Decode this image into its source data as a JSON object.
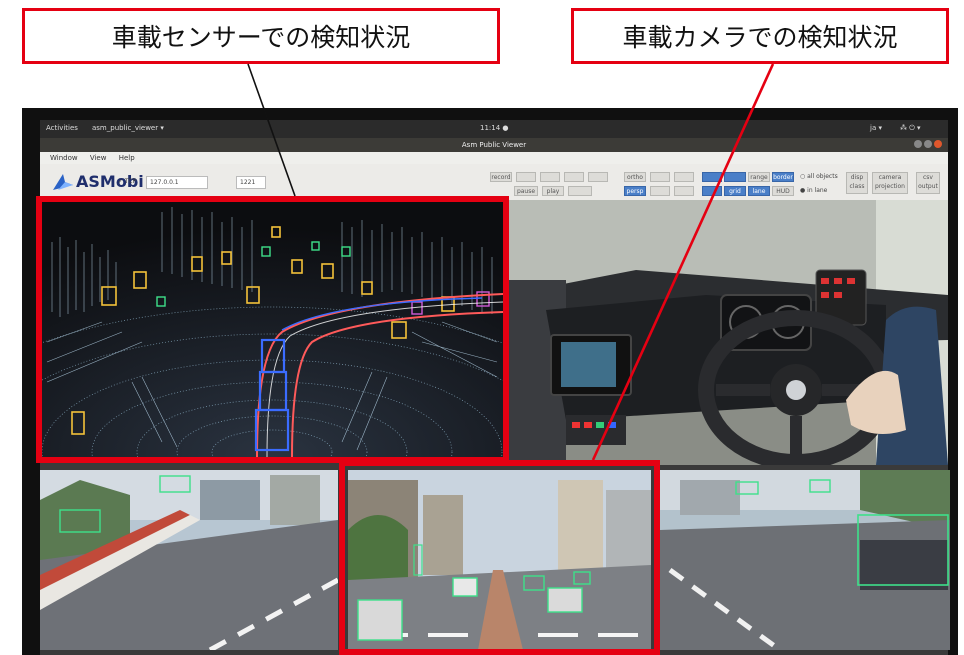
{
  "callouts": {
    "sensor": "車載センサーでの検知状況",
    "camera": "車載カメラでの検知状況"
  },
  "desktop": {
    "activities": "Activities",
    "app_menu": "asm_public_viewer ▾",
    "clock": "11:14 ●",
    "indicators": "ja ▾"
  },
  "window": {
    "title": "Asm Public Viewer",
    "menus": [
      "Window",
      "View",
      "Help"
    ]
  },
  "toolbar": {
    "logo": "ASMobi",
    "tcp_label": "✓ TCP",
    "tcp_address": "127.0.0.1",
    "port": "1221",
    "buttons": {
      "record": "record",
      "pause": "pause",
      "play": "play",
      "ortho": "ortho",
      "persp": "persp",
      "all_objects": "all objects",
      "in_lane": "in lane",
      "disp_class": "disp class",
      "camera_projection": "camera projection",
      "csv_output": "csv output",
      "range": "range",
      "border": "border",
      "grid": "grid",
      "lane": "lane",
      "hud": "HUD"
    }
  },
  "colors": {
    "callout_red": "#e50012",
    "lidar_points": "#9fc8e0",
    "vehicle_box": "#f4c23a",
    "path_blue": "#3b6cff",
    "path_red": "#ff5a5a",
    "detect_green": "#3ee08a"
  }
}
